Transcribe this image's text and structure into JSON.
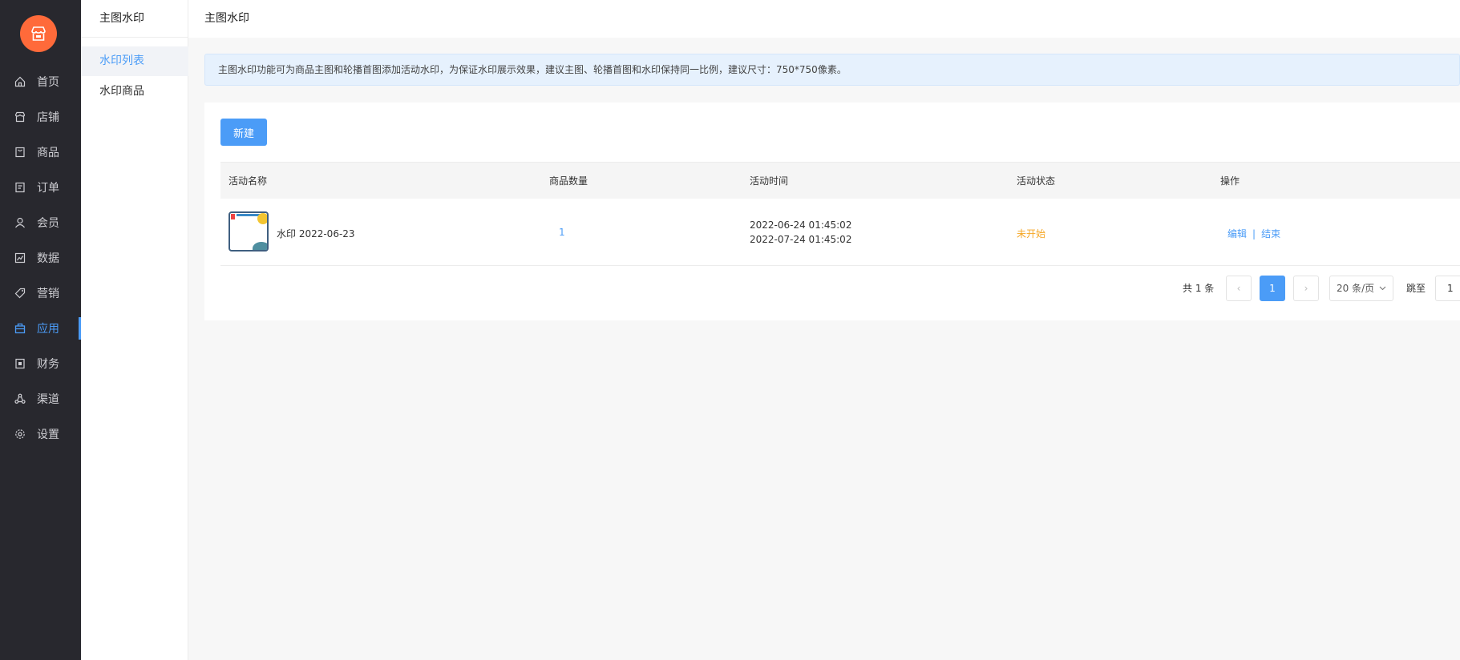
{
  "sidebar": {
    "items": [
      {
        "label": "首页",
        "icon": "home-icon"
      },
      {
        "label": "店铺",
        "icon": "store-icon"
      },
      {
        "label": "商品",
        "icon": "goods-icon"
      },
      {
        "label": "订单",
        "icon": "order-icon"
      },
      {
        "label": "会员",
        "icon": "user-icon"
      },
      {
        "label": "数据",
        "icon": "chart-icon"
      },
      {
        "label": "营销",
        "icon": "tag-icon"
      },
      {
        "label": "应用",
        "icon": "app-icon",
        "active": true
      },
      {
        "label": "财务",
        "icon": "finance-icon"
      },
      {
        "label": "渠道",
        "icon": "channel-icon"
      },
      {
        "label": "设置",
        "icon": "gear-icon"
      }
    ]
  },
  "subnav": {
    "title": "主图水印",
    "items": [
      {
        "label": "水印列表",
        "active": true
      },
      {
        "label": "水印商品"
      }
    ]
  },
  "header": {
    "title": "主图水印"
  },
  "notice": {
    "text": "主图水印功能可为商品主图和轮播首图添加活动水印，为保证水印展示效果，建议主图、轮播首图和水印保持同一比例，建议尺寸：750*750像素。"
  },
  "toolbar": {
    "new_label": "新建"
  },
  "table": {
    "columns": [
      "活动名称",
      "商品数量",
      "活动时间",
      "活动状态",
      "操作"
    ],
    "rows": [
      {
        "name": "水印 2022-06-23",
        "count": "1",
        "start": "2022-06-24 01:45:02",
        "end": "2022-07-24 01:45:02",
        "status": "未开始",
        "edit": "编辑",
        "sep": "|",
        "finish": "结束"
      }
    ]
  },
  "pagination": {
    "total": "共 1 条",
    "prev": "‹",
    "current": "1",
    "next": "›",
    "page_size": "20 条/页",
    "jump_label": "跳至",
    "jump_value": "1"
  },
  "colors": {
    "accent": "#4b9cf7",
    "logo": "#ff6a3a",
    "status_pending": "#f5a623",
    "sidebar_bg": "#28282e"
  }
}
